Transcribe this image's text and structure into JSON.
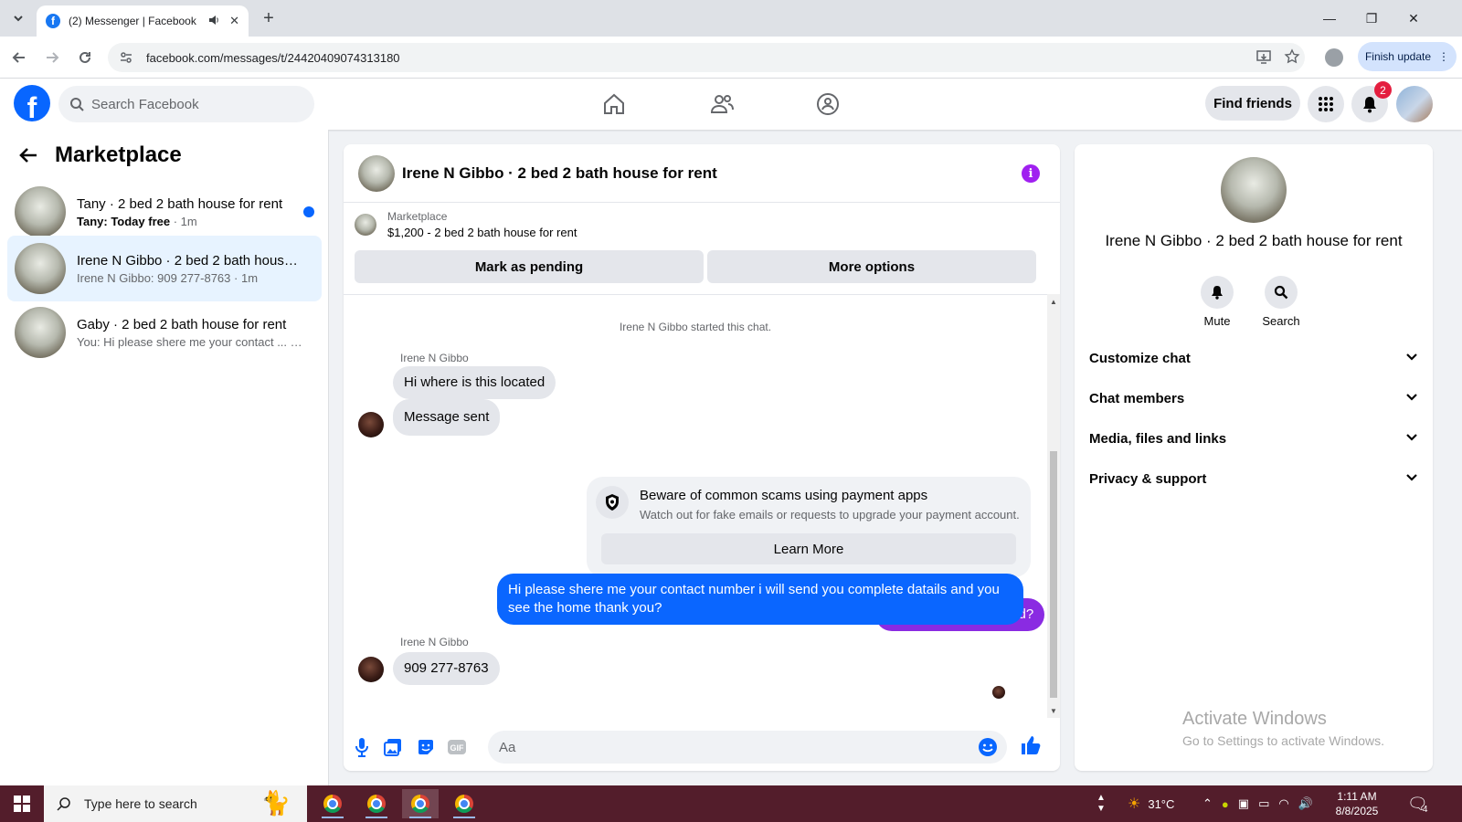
{
  "browser": {
    "tab_title": "(2) Messenger | Facebook",
    "url": "facebook.com/messages/t/24420409074313180",
    "finish_update": "Finish update",
    "new_tab_symbol": "+"
  },
  "fb_header": {
    "logo_letter": "f",
    "search_placeholder": "Search Facebook",
    "find_friends": "Find friends",
    "notification_count": "2",
    "nav_icons": [
      "home-icon",
      "friends-icon",
      "groups-icon"
    ]
  },
  "sidebar": {
    "title": "Marketplace",
    "conversations": [
      {
        "name": "Tany · 2 bed 2 bath house for rent",
        "preview": "Tany: Today free",
        "time": "1m",
        "unread": true
      },
      {
        "name": "Irene N Gibbo · 2 bed 2 bath house for rent",
        "preview": "Irene N Gibbo: 909 277-8763",
        "time": "1m",
        "unread": false,
        "active": true
      },
      {
        "name": "Gaby · 2 bed 2 bath house for rent",
        "preview": "You: Hi please shere me your contact ...",
        "time": "1m",
        "unread": false
      }
    ]
  },
  "chat": {
    "title": "Irene N Gibbo · 2 bed 2 bath house for rent",
    "listing_label": "Marketplace",
    "listing_price": "$1,200 - 2 bed 2 bath house for rent",
    "mark_pending": "Mark as pending",
    "more_options": "More options",
    "system_msg": "Irene N Gibbo started this chat.",
    "sender_name": "Irene N Gibbo",
    "msg_in_1": "Hi where is this located",
    "msg_in_2": "Message sent",
    "msg_out_1": "Yes, are you interested?",
    "scam_title": "Beware of common scams using payment apps",
    "scam_desc": "Watch out for fake emails or requests to upgrade your payment account.",
    "learn_more": "Learn More",
    "msg_out_2": "Hi please shere me your contact number i will send you complete datails and you see the home thank you?",
    "sender_name_2": "Irene N Gibbo",
    "msg_in_3": "909 277-8763",
    "composer_placeholder": "Aa",
    "colors": {
      "purple_bubble": "#8a2be2",
      "blue_bubble": "#0a66ff",
      "info": "#a020f0"
    }
  },
  "right_panel": {
    "name": "Irene N Gibbo · 2 bed 2 bath house for rent",
    "mute": "Mute",
    "search": "Search",
    "sections": [
      "Customize chat",
      "Chat members",
      "Media, files and links",
      "Privacy & support"
    ],
    "watermark_1": "Activate Windows",
    "watermark_2": "Go to Settings to activate Windows."
  },
  "taskbar": {
    "search_placeholder": "Type here to search",
    "weather": "31°C",
    "time": "1:11 AM",
    "date": "8/8/2025",
    "notif_count": "4"
  }
}
